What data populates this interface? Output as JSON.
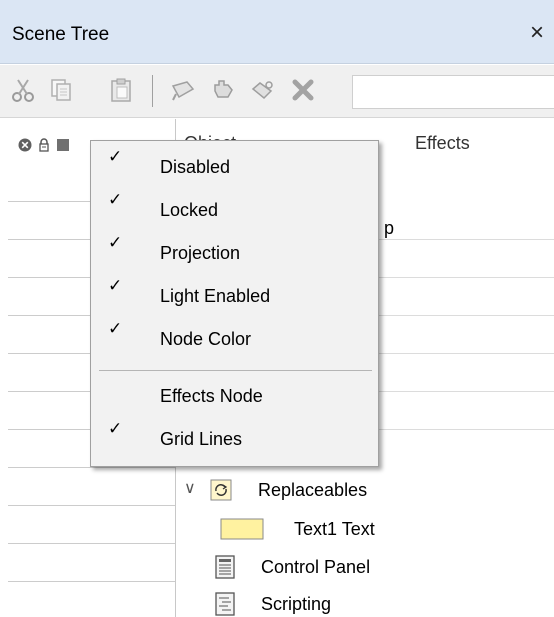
{
  "window": {
    "title": "Scene Tree",
    "close_glyph": "×"
  },
  "toolbar": {
    "icons": [
      "scissors-icon",
      "copy-icon",
      "paste-icon",
      "tag-icon",
      "move-icon",
      "link-icon",
      "delete-icon"
    ]
  },
  "header": {
    "object_label": "Object",
    "effects_label": "Effects"
  },
  "context_menu": {
    "check_glyph": "✓",
    "items": [
      {
        "label": "Disabled",
        "checked": true
      },
      {
        "label": "Locked",
        "checked": true
      },
      {
        "label": "Projection",
        "checked": true
      },
      {
        "label": "Light Enabled",
        "checked": true
      },
      {
        "label": "Node Color",
        "checked": true
      },
      {
        "label": "Effects Node",
        "checked": false
      },
      {
        "label": "Grid Lines",
        "checked": true
      }
    ]
  },
  "tree": {
    "partial_text": "p",
    "items": [
      {
        "label": "Replaceables",
        "icon": "replaceables-icon",
        "expander": "∨"
      },
      {
        "label": "Text1 Text",
        "icon": "text-swatch-icon"
      },
      {
        "label": "Control Panel",
        "icon": "control-panel-icon"
      },
      {
        "label": "Scripting",
        "icon": "scripting-icon"
      }
    ]
  }
}
